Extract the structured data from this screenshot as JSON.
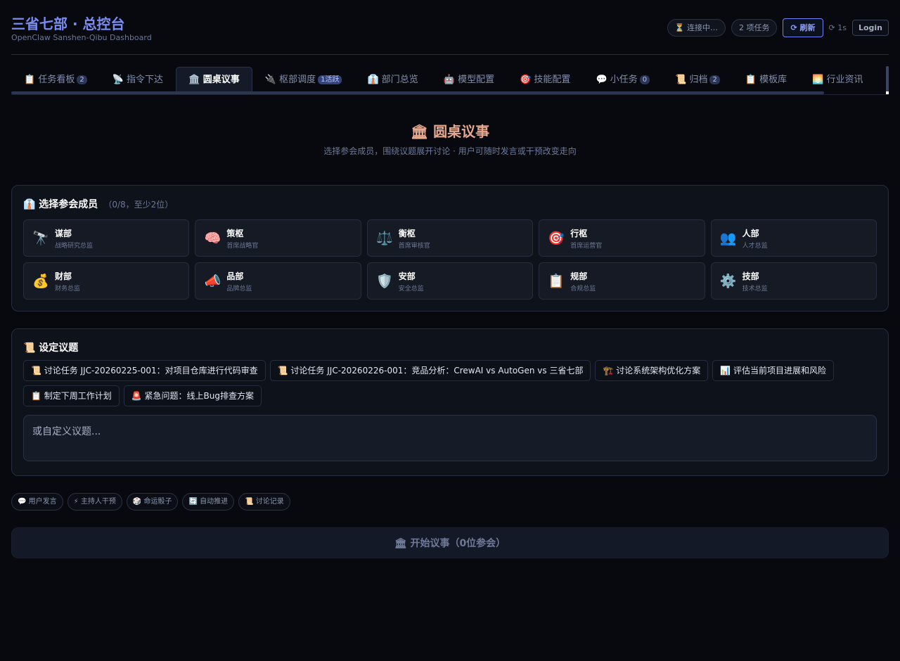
{
  "header": {
    "title": "三省七部 · 总控台",
    "subtitle": "OpenClaw Sanshen-Qibu Dashboard",
    "status": "⏳ 连接中…",
    "tasks": "2 项任务",
    "refresh": "⟳ 刷新",
    "interval": "⟳ 1s",
    "login": "Login"
  },
  "tabs": [
    {
      "label": "📋 任务看板",
      "count": "2"
    },
    {
      "label": "📡 指令下达",
      "count": ""
    },
    {
      "label": "🏛️ 圆桌议事",
      "count": ""
    },
    {
      "label": "🔌 枢部调度",
      "count": "1活跃"
    },
    {
      "label": "👔 部门总览",
      "count": ""
    },
    {
      "label": "🤖 模型配置",
      "count": ""
    },
    {
      "label": "🎯 技能配置",
      "count": ""
    },
    {
      "label": "💬 小任务",
      "count": "0"
    },
    {
      "label": "📜 归档",
      "count": "2"
    },
    {
      "label": "📋 模板库",
      "count": ""
    },
    {
      "label": "🌅 行业资讯",
      "count": ""
    }
  ],
  "active_tab": 2,
  "section": {
    "title": "🏛 圆桌议事",
    "desc": "选择参会成员，围绕议题展开讨论 · 用户可随时发言或干预改变走向"
  },
  "members_panel": {
    "title": "👔 选择参会成员",
    "hint": "（0/8，至少2位）",
    "members": [
      {
        "icon": "🔭",
        "name": "谋部",
        "role": "战略研究总监"
      },
      {
        "icon": "🧠",
        "name": "策枢",
        "role": "首席战略官"
      },
      {
        "icon": "⚖️",
        "name": "衡枢",
        "role": "首席审核官"
      },
      {
        "icon": "🎯",
        "name": "行枢",
        "role": "首席运营官"
      },
      {
        "icon": "👥",
        "name": "人部",
        "role": "人才总监"
      },
      {
        "icon": "💰",
        "name": "财部",
        "role": "财务总监"
      },
      {
        "icon": "📣",
        "name": "品部",
        "role": "品牌总监"
      },
      {
        "icon": "🛡️",
        "name": "安部",
        "role": "安全总监"
      },
      {
        "icon": "📋",
        "name": "规部",
        "role": "合规总监"
      },
      {
        "icon": "⚙️",
        "name": "技部",
        "role": "技术总监"
      }
    ]
  },
  "topic_panel": {
    "title": "📜 设定议题",
    "topics": [
      "📜 讨论任务 JJC-20260225-001：对项目仓库进行代码审查",
      "📜 讨论任务 JJC-20260226-001：竞品分析：CrewAI vs AutoGen vs 三省七部",
      "🏗️ 讨论系统架构优化方案",
      "📊 评估当前项目进展和风险",
      "📋 制定下周工作计划",
      "🚨 紧急问题：线上Bug排查方案"
    ],
    "placeholder": "或自定义议题..."
  },
  "features": [
    "💬 用户发言",
    "⚡ 主持人干预",
    "🎲 命运骰子",
    "🔄 自动推进",
    "📜 讨论记录"
  ],
  "start_button": "🏛 开始议事（0位参会）"
}
